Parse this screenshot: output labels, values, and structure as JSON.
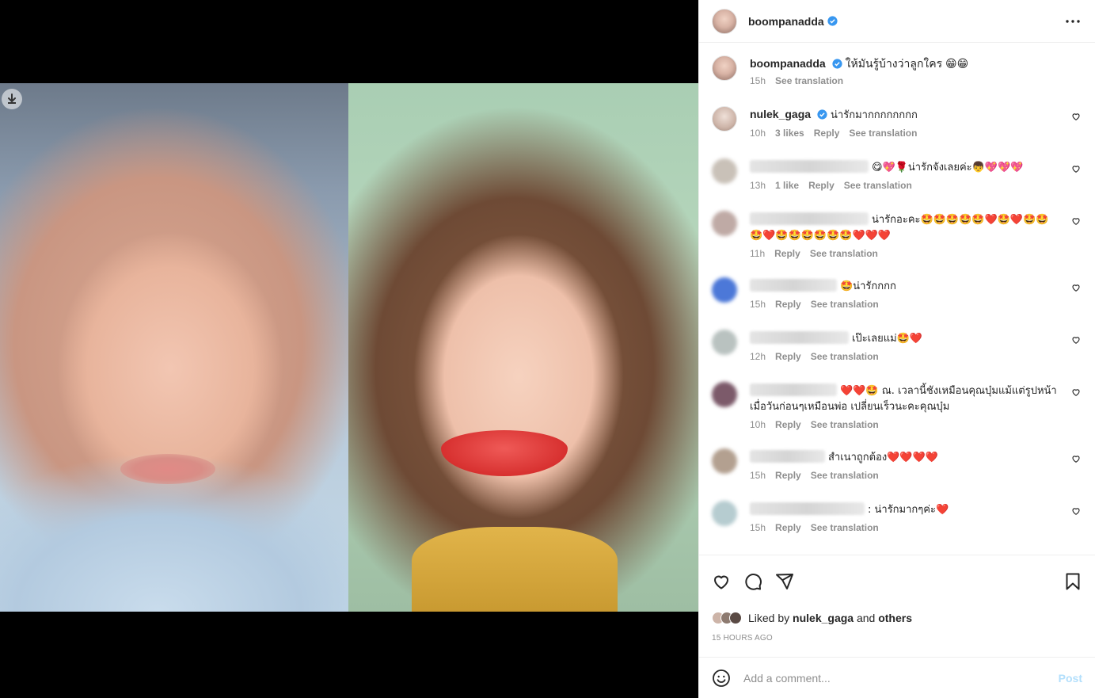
{
  "post": {
    "author": "boompanadda",
    "caption": "ให้มันรู้บ้างว่าลูกใคร 😁😁",
    "caption_time": "15h",
    "see_translation": "See translation"
  },
  "comments": [
    {
      "user": "nulek_gaga",
      "verified": true,
      "blurred": false,
      "text": "น่ารักมากกกกกกกก",
      "time": "10h",
      "likes": "3 likes",
      "reply": "Reply",
      "translate": "See translation",
      "avatar_color": "#cdb4a8"
    },
    {
      "user": "",
      "verified": false,
      "blurred": true,
      "text": "😋💖🌹น่ารักจังเลยค่ะ👦💖💖💖",
      "time": "13h",
      "likes": "1 like",
      "reply": "Reply",
      "translate": "See translation",
      "avatar_color": "#c9c1b8"
    },
    {
      "user": "",
      "verified": false,
      "blurred": true,
      "text": "น่ารักอะคะ🤩🤩🤩🤩🤩❤️🤩❤️🤩🤩🤩❤️🤩🤩🤩🤩🤩🤩❤️❤️❤️",
      "time": "11h",
      "likes": "",
      "reply": "Reply",
      "translate": "See translation",
      "avatar_color": "#bfaaa5"
    },
    {
      "user": "",
      "verified": false,
      "blurred": true,
      "text": "🤩น่ารักกกก",
      "time": "15h",
      "likes": "",
      "reply": "Reply",
      "translate": "See translation",
      "avatar_color": "#4c78d8"
    },
    {
      "user": "",
      "verified": false,
      "blurred": true,
      "text": "เป๊ะเลยแม่🤩❤️",
      "time": "12h",
      "likes": "",
      "reply": "Reply",
      "translate": "See translation",
      "avatar_color": "#b9c2c0"
    },
    {
      "user": "",
      "verified": false,
      "blurred": true,
      "text": "❤️❤️🤩 ณ. เวลานี้ชังเหมือนคุณบุ๋มแม้แต่รูปหน้า เมื่อวันก่อนๆเหมือนพ่อ เปลี่ยนเร็วนะคะคุณบุ๋ม",
      "time": "10h",
      "likes": "",
      "reply": "Reply",
      "translate": "See translation",
      "avatar_color": "#7c5a6a"
    },
    {
      "user": "",
      "verified": false,
      "blurred": true,
      "text": "สำเนาถูกต้อง❤️❤️❤️❤️",
      "time": "15h",
      "likes": "",
      "reply": "Reply",
      "translate": "See translation",
      "avatar_color": "#b3a090"
    },
    {
      "user": "",
      "verified": false,
      "blurred": true,
      "text": ": น่ารักมากๆค่ะ❤️",
      "time": "15h",
      "likes": "",
      "reply": "Reply",
      "translate": "See translation",
      "avatar_color": "#b6ccd0"
    }
  ],
  "likes": {
    "prefix": "Liked by",
    "user": "nulek_gaga",
    "and": "and",
    "others": "others"
  },
  "timestamp": "15 HOURS AGO",
  "add_comment": {
    "placeholder": "Add a comment...",
    "post_label": "Post"
  },
  "colors": {
    "verified": "#3897f0",
    "post_disabled": "#b2dffc",
    "meta": "#8e8e8e"
  }
}
